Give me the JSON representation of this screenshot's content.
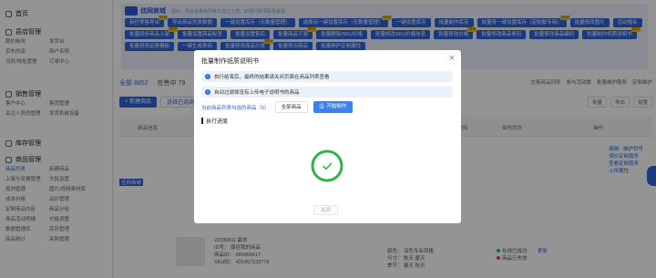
{
  "sidebar": {
    "groups": [
      {
        "title": "首页",
        "items": []
      },
      {
        "title": "县店管理",
        "items": [
          "数的板块",
          "发货台",
          "京东的店",
          "商户名称",
          "司机/地址管理",
          "订单中心"
        ]
      },
      {
        "title": "销售管理",
        "items": [
          "客户中心",
          "售货管理",
          "关注人员的管理",
          "发货系统设备"
        ]
      },
      {
        "title": "库存管理",
        "items": []
      },
      {
        "title": "商品管理",
        "items": [
          "商品列表",
          "新建商品",
          "上架与发展管理",
          "大批设置",
          "规则管理",
          "图片/视频素材库",
          "成本价格",
          "品价管理",
          "定制商品内容",
          "商品分组",
          "商品活动明细",
          "价格调整",
          "数据管理库",
          "库存管理",
          "商品统计",
          "采购管理"
        ]
      }
    ]
  },
  "banner": {
    "brand": "佳网商城",
    "tip": "提示：商品批量修改等工具已上线，如遇问题请联系客服",
    "chips": [
      "新任零售导出",
      "导出商品列表数据",
      "一键设置库存（无数量管理）",
      "选择另一键设置库存（无数量管理）",
      "一键设置库存",
      "批量制作库存",
      "批量导一键设置库存（定制款专用）",
      "批量修改图片",
      "活动报名",
      "批量同步商品上架",
      "批量设置商品标签",
      "批量设置售后",
      "批量商品下架",
      "批量删除/SKU价格",
      "批量修改SKU价格信息",
      "批量修改价格",
      "批量修改商品条码",
      "批量修改商品编码",
      "批量制作纸质说明书",
      "批量修改运费模板",
      "一键生成条码",
      "批量修改商品分类",
      "批量导出商品",
      "批量维护定制属性"
    ],
    "new_badge": "NEW"
  },
  "stats": {
    "all_label": "全部 8852",
    "on_sale_label": "在售中 79"
  },
  "right_links": [
    "在售商品列表",
    "参与活动数",
    "批量维护服务",
    "定制维护"
  ],
  "toolbar": {
    "new_button": "+ 新建商品",
    "select_button": "选择已选商品"
  },
  "toolbar_right": [
    "批量",
    "导出",
    "设置"
  ],
  "table": {
    "headers": [
      "商品信息",
      "价格",
      "库存",
      "销量",
      "创建时间",
      "审核状态",
      "操作"
    ],
    "row_links": [
      "编辑 · 维护供号",
      "调价定制服务",
      "查看定制服务",
      "上传属性"
    ],
    "row_tag": "佳网商城",
    "row2": {
      "line1": "22030811 副本",
      "line2": "ID号：  康佳我的商品",
      "line3": "商品ID：  489456617",
      "line4": "SKU码：  425457133779",
      "status_ok": "在线已成功",
      "status_err": "商品已失效",
      "attr1": "颜色：  深色专业风格",
      "attr2": "尺寸：  秋天  夏天",
      "attr3": "季节：  春天  秋天",
      "action": "更新"
    }
  },
  "modal": {
    "title": "批量制作纸质说明书",
    "close": "×",
    "notices": [
      "执行结束后，最终的结果请关闭页面在商品列表查看",
      "自动过滤掉没有上传电子说明书的商品"
    ],
    "notice_icon": "i",
    "tab_current": "当前商品列表勾选的商品（5）",
    "tab_all": "全部商品",
    "start_button": "开始制作",
    "progress_label": "执行进度",
    "close_button": "关闭",
    "done_color": "#2fb344"
  }
}
